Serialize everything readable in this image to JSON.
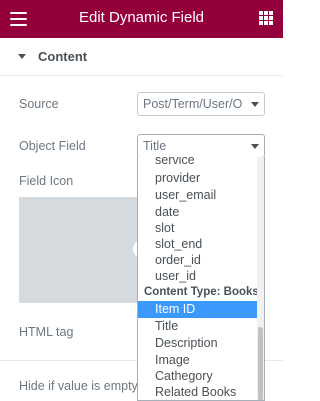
{
  "header": {
    "title": "Edit Dynamic Field",
    "menu_icon": "hamburger-menu-icon",
    "apps_icon": "grid-apps-icon"
  },
  "section": {
    "label": "Content",
    "icon": "caret-down-icon"
  },
  "controls": {
    "source_label": "Source",
    "source_value": "Post/Term/User/O",
    "object_field_label": "Object Field",
    "object_field_value": "Title",
    "field_icon_label": "Field Icon",
    "html_tag_label": "HTML tag",
    "hide_if_empty_label": "Hide if value is empty"
  },
  "dropdown": {
    "options_before": [
      "service",
      "provider",
      "user_email",
      "date",
      "slot",
      "slot_end",
      "order_id",
      "user_id"
    ],
    "group_label": "Content Type: Books",
    "selected": "Item ID",
    "options_after": [
      "Title",
      "Description",
      "Image",
      "Cathegory",
      "Related Books"
    ]
  },
  "colors": {
    "header_bg": "#93003c",
    "selected_bg": "#3b99fc",
    "media_bg": "#d5dadf"
  }
}
